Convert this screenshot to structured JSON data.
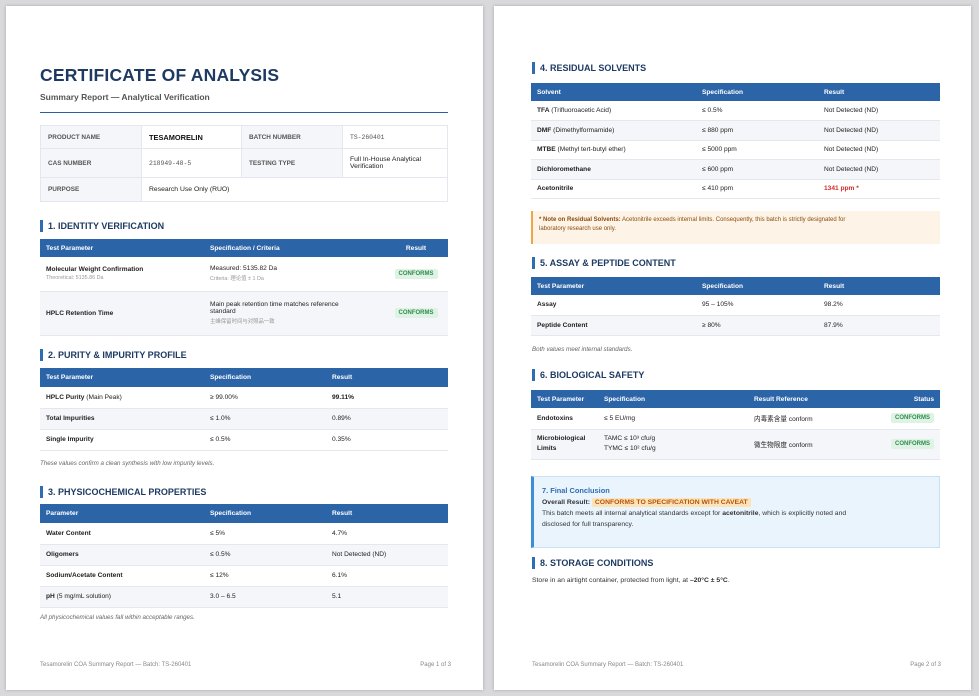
{
  "page1": {
    "title": "CERTIFICATE OF ANALYSIS",
    "subtitle": "Summary Report — Analytical Verification",
    "info": {
      "product_name_label": "PRODUCT NAME",
      "product_name": "TESAMORELIN",
      "batch_number_label": "BATCH NUMBER",
      "batch_number": "TS-260401",
      "cas_number_label": "CAS NUMBER",
      "cas_number": "218949-48-5",
      "testing_type_label": "TESTING TYPE",
      "testing_type_line1": "Full In-House Analytical",
      "testing_type_line2": "Verification",
      "purpose_label": "PURPOSE",
      "purpose": "Research Use Only (RUO)"
    },
    "s1": {
      "title": "1. IDENTITY VERIFICATION",
      "headers": [
        "Test Parameter",
        "Specification / Criteria",
        "Result"
      ],
      "row1_param": "Molecular Weight Confirmation",
      "row1_param_sub": "Theoretical: 5135.86 Da",
      "row1_spec": "Measured: 5135.82 Da",
      "row1_spec_sub": "Criteria: 理论值 ± 1 Da",
      "row1_result": "CONFORMS",
      "row2_param": "HPLC Retention Time",
      "row2_spec_line1": "Main peak retention time matches reference",
      "row2_spec_line2": "standard",
      "row2_spec_sub": "主峰保留时间与对照品一致",
      "row2_result": "CONFORMS"
    },
    "s2": {
      "title": "2. PURITY & IMPURITY PROFILE",
      "headers": [
        "Test Parameter",
        "Specification",
        "Result"
      ],
      "rows": [
        {
          "param_bold": "HPLC Purity",
          "param_rest": " (Main Peak)",
          "spec": "≥ 99.00%",
          "result": "99.11%"
        },
        {
          "param_bold": "Total Impurities",
          "param_rest": "",
          "spec": "≤ 1.0%",
          "result": "0.89%"
        },
        {
          "param_bold": "Single Impurity",
          "param_rest": "",
          "spec": "≤ 0.5%",
          "result": "0.35%"
        }
      ],
      "note": "These values confirm a clean synthesis with low impurity levels."
    },
    "s3": {
      "title": "3. PHYSICOCHEMICAL PROPERTIES",
      "headers": [
        "Parameter",
        "Specification",
        "Result"
      ],
      "rows": [
        {
          "param_bold": "Water Content",
          "param_rest": "",
          "spec": "≤ 5%",
          "result": "4.7%"
        },
        {
          "param_bold": "Oligomers",
          "param_rest": "",
          "spec": "≤ 0.5%",
          "result": "Not Detected (ND)"
        },
        {
          "param_bold": "Sodium/Acetate Content",
          "param_rest": "",
          "spec": "≤ 12%",
          "result": "6.1%"
        },
        {
          "param_bold": "pH",
          "param_rest": " (5 mg/mL solution)",
          "spec": "3.0 – 6.5",
          "result": "5.1"
        }
      ],
      "note": "All physicochemical values fall within acceptable ranges."
    },
    "footer_left": "Tesamorelin COA Summary Report — Batch: TS-260401",
    "footer_right": "Page 1 of 3"
  },
  "page2": {
    "s4": {
      "title": "4. RESIDUAL SOLVENTS",
      "headers": [
        "Solvent",
        "Specification",
        "Result"
      ],
      "rows": [
        {
          "name_bold": "TFA",
          "name_rest": " (Trifluoroacetic Acid)",
          "spec": "≤ 0.5%",
          "result": "Not Detected (ND)"
        },
        {
          "name_bold": "DMF",
          "name_rest": " (Dimethylformamide)",
          "spec": "≤ 880 ppm",
          "result": "Not Detected (ND)"
        },
        {
          "name_bold": "MTBE",
          "name_rest": " (Methyl tert-butyl ether)",
          "spec": "≤ 5000 ppm",
          "result": "Not Detected (ND)"
        },
        {
          "name_bold": "Dichloromethane",
          "name_rest": "",
          "spec": "≤ 600 ppm",
          "result": "Not Detected (ND)"
        },
        {
          "name_bold": "Acetonitrile",
          "name_rest": "",
          "spec": "≤ 410 ppm",
          "result": "1341 ppm *"
        }
      ],
      "warn_bold": "* Note on Residual Solvents:",
      "warn_line1": " Acetonitrile exceeds internal limits. Consequently, this batch is strictly designated for",
      "warn_line2": "laboratory research use only."
    },
    "s5": {
      "title": "5. ASSAY & PEPTIDE CONTENT",
      "headers": [
        "Test Parameter",
        "Specification",
        "Result"
      ],
      "rows": [
        {
          "param": "Assay",
          "spec": "95 – 105%",
          "result": "98.2%"
        },
        {
          "param": "Peptide Content",
          "spec": "≥ 80%",
          "result": "87.9%"
        }
      ],
      "note": "Both values meet internal standards."
    },
    "s6": {
      "title": "6. BIOLOGICAL SAFETY",
      "headers": [
        "Test Parameter",
        "Specification",
        "Result Reference",
        "Status"
      ],
      "row1_param": "Endotoxins",
      "row1_spec": "≤ 5 EU/mg",
      "row1_ref": "内毒素含量 conform",
      "row1_status": "CONFORMS",
      "row2_param_line1": "Microbiological",
      "row2_param_line2": "Limits",
      "row2_spec_line1": "TAMC ≤ 10³ cfu/g",
      "row2_spec_line2": "TYMC ≤ 10² cfu/g",
      "row2_ref": "微生物限度 conform",
      "row2_status": "CONFORMS"
    },
    "s7": {
      "title": "7. Final Conclusion",
      "overall_label": "Overall Result:",
      "overall_value": "CONFORMS TO SPECIFICATION WITH CAVEAT",
      "text_before": "This batch meets all internal analytical standards except for ",
      "text_bold": "acetonitrile",
      "text_after": ", which is explicitly noted and",
      "text_line2": "disclosed for full transparency."
    },
    "s8": {
      "title": "8. STORAGE CONDITIONS",
      "text_before": "Store in an airtight container, protected from light, at ",
      "text_bold": "–20°C ± 5°C",
      "text_after": "."
    },
    "footer_left": "Tesamorelin COA Summary Report — Batch: TS-260401",
    "footer_right": "Page 2 of 3"
  },
  "colors": {
    "header_blue": "#2c64a8",
    "title_navy": "#1e3a63",
    "conform_green": "#2e8b4e",
    "alert_red": "#d42a2a",
    "warning_orange": "#f0a347"
  }
}
